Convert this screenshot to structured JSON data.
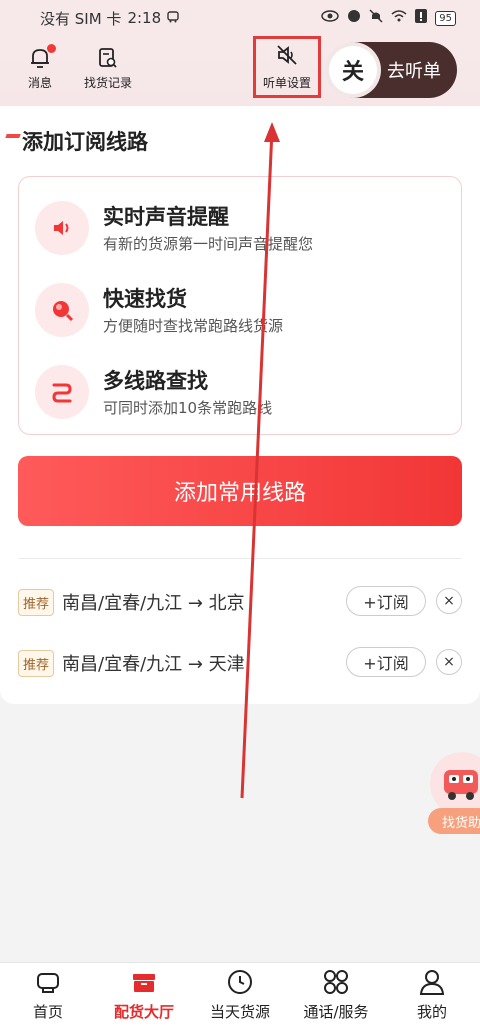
{
  "status_bar": {
    "carrier": "没有 SIM 卡",
    "time": "2:18",
    "battery": "95"
  },
  "top_nav": {
    "messages_label": "消息",
    "cargo_records_label": "找货记录",
    "listen_settings_label": "听单设置",
    "toggle_state": "关",
    "toggle_label": "去听单"
  },
  "section_title": "添加订阅线路",
  "features": [
    {
      "title": "实时声音提醒",
      "subtitle": "有新的货源第一时间声音提醒您",
      "icon": "speaker-icon"
    },
    {
      "title": "快速找货",
      "subtitle": "方便随时查找常跑路线货源",
      "icon": "search-icon"
    },
    {
      "title": "多线路查找",
      "subtitle": "可同时添加10条常跑路线",
      "icon": "route-icon"
    }
  ],
  "add_button_label": "添加常用线路",
  "routes": [
    {
      "tag": "推荐",
      "path": "南昌/宜春/九江 → 北京",
      "subscribe_label": "+订阅",
      "close": "×"
    },
    {
      "tag": "推荐",
      "path": "南昌/宜春/九江 → 天津",
      "subscribe_label": "+订阅",
      "close": "×"
    }
  ],
  "float_button_label": "找货助",
  "tabs": [
    {
      "label": "首页",
      "icon": "home-icon",
      "active": false
    },
    {
      "label": "配货大厅",
      "icon": "cargo-hall-icon",
      "active": true
    },
    {
      "label": "当天货源",
      "icon": "clock-icon",
      "active": false
    },
    {
      "label": "通话/服务",
      "icon": "grid-icon",
      "active": false
    },
    {
      "label": "我的",
      "icon": "user-icon",
      "active": false
    }
  ],
  "colors": {
    "accent": "#f23636",
    "highlight_box": "#e23b3b",
    "toggle_bg": "#4a2e2e"
  }
}
